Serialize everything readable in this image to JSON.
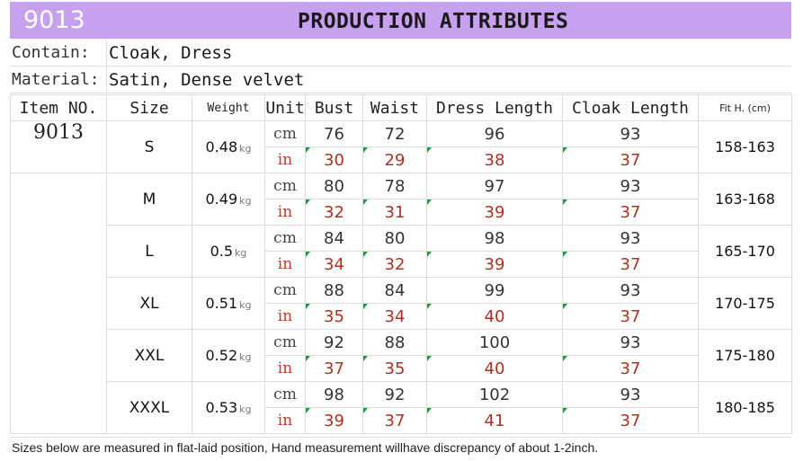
{
  "header": {
    "item_code": "9013",
    "title": "PRODUCTION ATTRIBUTES"
  },
  "info": {
    "contain_label": "Contain:",
    "contain_value": "Cloak, Dress",
    "material_label": "Material:",
    "material_value": "Satin, Dense velvet"
  },
  "table": {
    "headers": {
      "item_no": "Item NO.",
      "size": "Size",
      "weight": "Weight",
      "unit": "Unit",
      "bust": "Bust",
      "waist": "Waist",
      "dress_length": "Dress Length",
      "cloak_length": "Cloak Length",
      "fit_height": "Fit H. (cm)"
    },
    "item_no": "9013",
    "weight_unit": "kg",
    "unit_cm": "cm",
    "unit_in": "in",
    "rows": [
      {
        "size": "S",
        "weight": "0.48",
        "cm": {
          "bust": "76",
          "waist": "72",
          "dress": "96",
          "cloak": "93"
        },
        "in": {
          "bust": "30",
          "waist": "29",
          "dress": "38",
          "cloak": "37"
        },
        "fit": "158-163"
      },
      {
        "size": "M",
        "weight": "0.49",
        "cm": {
          "bust": "80",
          "waist": "78",
          "dress": "97",
          "cloak": "93"
        },
        "in": {
          "bust": "32",
          "waist": "31",
          "dress": "39",
          "cloak": "37"
        },
        "fit": "163-168"
      },
      {
        "size": "L",
        "weight": "0.5",
        "cm": {
          "bust": "84",
          "waist": "80",
          "dress": "98",
          "cloak": "93"
        },
        "in": {
          "bust": "34",
          "waist": "32",
          "dress": "39",
          "cloak": "37"
        },
        "fit": "165-170"
      },
      {
        "size": "XL",
        "weight": "0.51",
        "cm": {
          "bust": "88",
          "waist": "84",
          "dress": "99",
          "cloak": "93"
        },
        "in": {
          "bust": "35",
          "waist": "34",
          "dress": "40",
          "cloak": "37"
        },
        "fit": "170-175"
      },
      {
        "size": "XXL",
        "weight": "0.52",
        "cm": {
          "bust": "92",
          "waist": "88",
          "dress": "100",
          "cloak": "93"
        },
        "in": {
          "bust": "37",
          "waist": "35",
          "dress": "40",
          "cloak": "37"
        },
        "fit": "175-180"
      },
      {
        "size": "XXXL",
        "weight": "0.53",
        "cm": {
          "bust": "98",
          "waist": "92",
          "dress": "102",
          "cloak": "93"
        },
        "in": {
          "bust": "39",
          "waist": "37",
          "dress": "41",
          "cloak": "37"
        },
        "fit": "180-185"
      }
    ]
  },
  "footer": {
    "note": "Sizes below are measured in flat-laid position, Hand measurement willhave discrepancy of about 1-2inch."
  },
  "colors": {
    "banner": "#c7a0f0",
    "inch_text": "#b03020",
    "corner_mark": "#1f9a3a"
  }
}
